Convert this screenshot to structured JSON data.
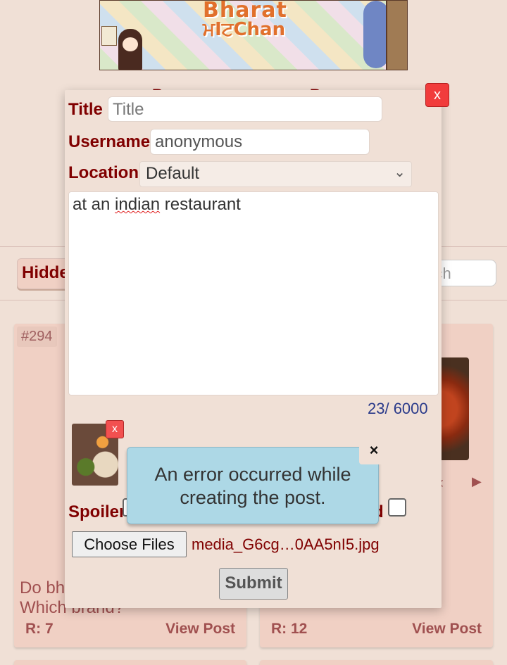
{
  "banner": {
    "logo_line1": "Bharat",
    "logo_line2": "ਮIਟChan"
  },
  "nav": {
    "left_fragment": "B",
    "right_fragment": "B"
  },
  "toolbar": {
    "hidden_label": "Hidden",
    "search_placeholder": "Search"
  },
  "cards": [
    {
      "id": "#294",
      "excerpt_line1": "Do bh",
      "excerpt_line2": "Which brand?",
      "replies": "R: 7",
      "view_label": "View Post"
    },
    {
      "id": "",
      "excerpt_line1": "",
      "excerpt_line2": "",
      "replies": "R: 12",
      "view_label": "View Post"
    }
  ],
  "modal": {
    "close_label": "x",
    "title_label": "Title",
    "title_placeholder": "Title",
    "username_label": "Username",
    "username_value": "anonymous",
    "location_label": "Location",
    "location_value": "Default",
    "body_before": "at an ",
    "body_misspelled": "indian",
    "body_after": " restaurant",
    "char_counter": "23/ 6000",
    "attachment_remove_label": "x",
    "spoiler_label": "Spoiler",
    "second_checkbox_label": "d",
    "choose_files_label": "Choose Files",
    "file_name": "media_G6cg…0AA5nI5.jpg",
    "submit_label": "Submit"
  },
  "toast": {
    "message": "An error occurred while creating the post.",
    "close_label": "×"
  },
  "colors": {
    "background": "#f0e0d6",
    "text": "#800000",
    "toast": "#add8e6",
    "close_red": "#f13c3c"
  }
}
